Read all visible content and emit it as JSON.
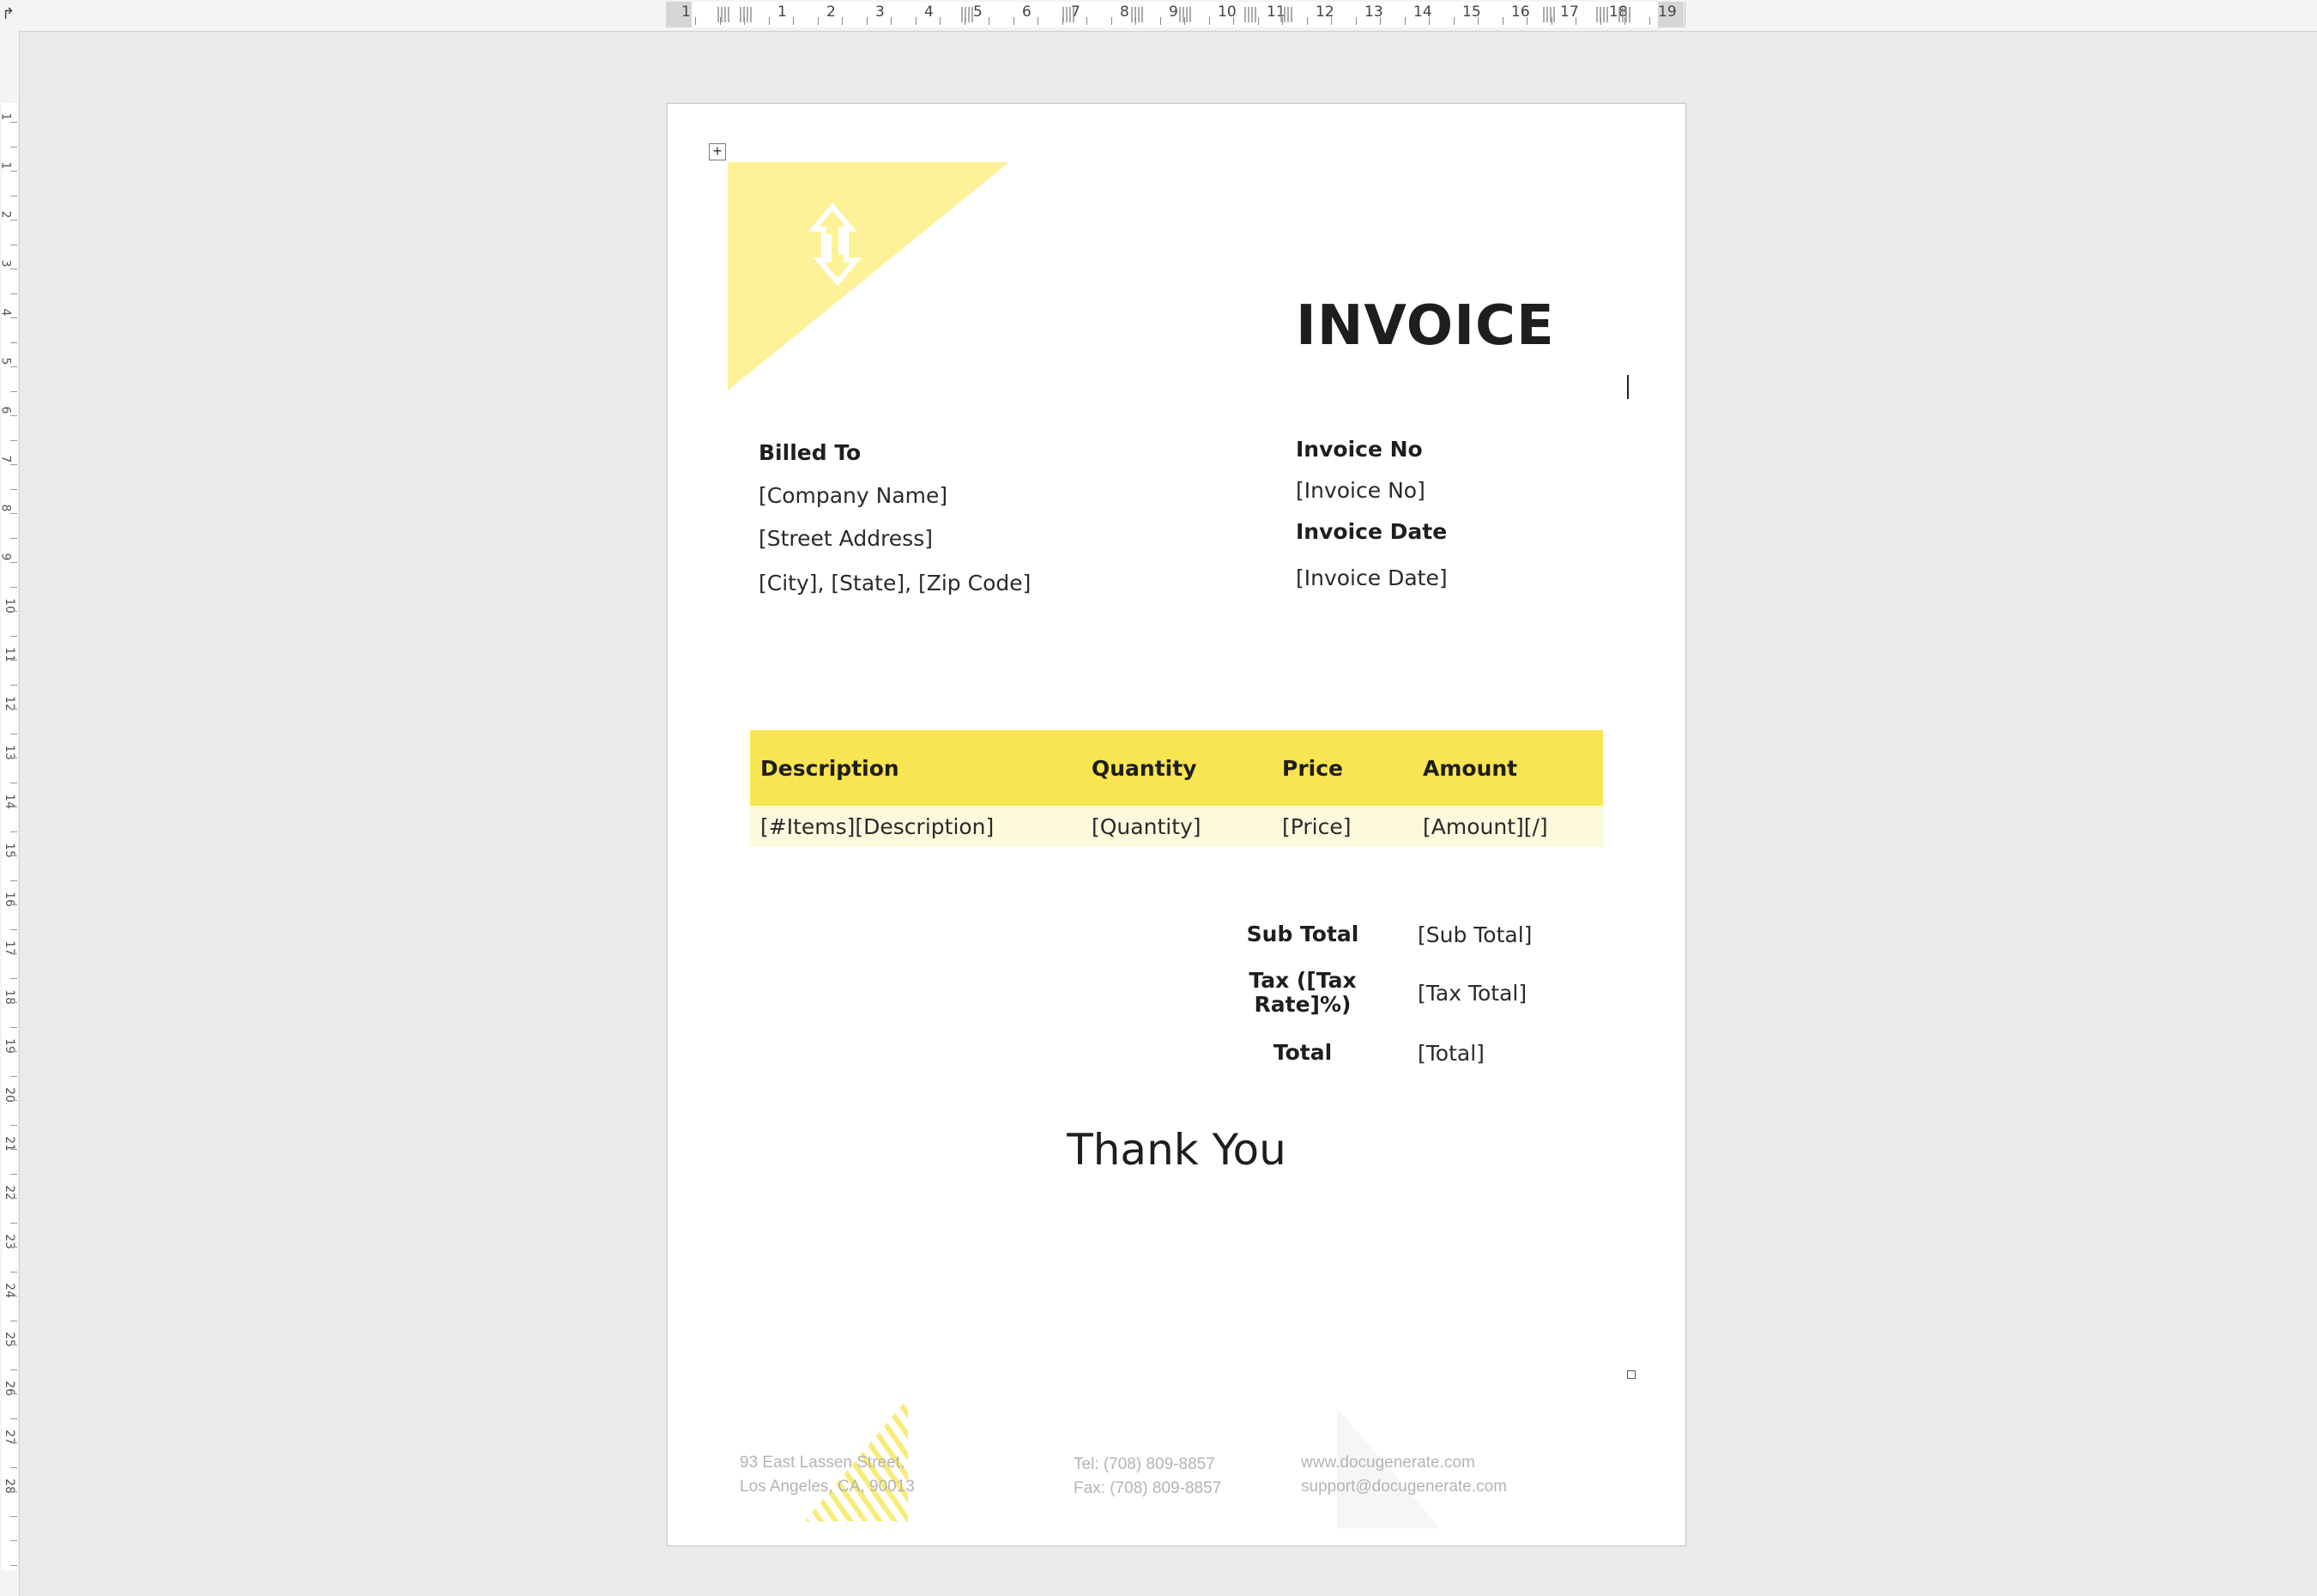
{
  "ruler": {
    "numbers": [
      "1",
      "1",
      "2",
      "3",
      "4",
      "5",
      "6",
      "7",
      "8",
      "9",
      "10",
      "11",
      "12",
      "13",
      "14",
      "15",
      "16",
      "17",
      "18",
      "19"
    ],
    "vnumbers": [
      "1",
      "1",
      "2",
      "3",
      "4",
      "5",
      "6",
      "7",
      "8",
      "9",
      "10",
      "11",
      "12",
      "13",
      "14",
      "15",
      "16",
      "17",
      "18",
      "19",
      "20",
      "21",
      "22",
      "23",
      "24",
      "25",
      "26",
      "27",
      "28"
    ]
  },
  "invoice": {
    "title": "INVOICE",
    "billed_to_label": "Billed To",
    "company": "[Company Name]",
    "street": "[Street Address]",
    "city": "[City], [State], [Zip Code]",
    "invoice_no_label": "Invoice No",
    "invoice_no": "[Invoice No]",
    "invoice_date_label": "Invoice Date",
    "invoice_date": "[Invoice Date]"
  },
  "table": {
    "headers": [
      "Description",
      "Quantity",
      "Price",
      "Amount"
    ],
    "row": [
      "[#Items][Description]",
      "[Quantity]",
      "[Price]",
      "[Amount][/]"
    ]
  },
  "totals": {
    "subtotal_label": "Sub Total",
    "subtotal": "[Sub Total]",
    "tax_label_1": "Tax ([Tax",
    "tax_label_2": "Rate]%)",
    "tax": "[Tax Total]",
    "total_label": "Total",
    "total": "[Total]"
  },
  "thanks": "Thank You",
  "footer": {
    "address_1": "93 East Lassen Street,",
    "address_2": "Los Angeles, CA, 90013",
    "tel": "Tel:  (708) 809-8857",
    "fax": "Fax: (708) 809-8857",
    "web": "www.docugenerate.com",
    "email": "support@docugenerate.com"
  },
  "colors": {
    "accent": "#f9e451",
    "accent_light": "#fdf297",
    "row_bg": "#fdf9dd"
  },
  "icons": [
    "table-anchor-icon",
    "swap-arrows-icon"
  ]
}
